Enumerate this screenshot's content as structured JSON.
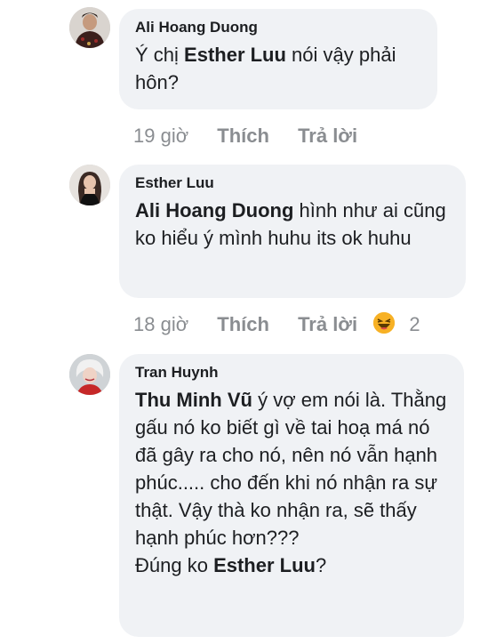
{
  "comments": [
    {
      "author": "Ali Hoang Duong",
      "text_parts": {
        "a": "Ý chị ",
        "mention": "Esther Luu",
        "b": " nói vậy phải hôn?"
      },
      "time": "19 giờ",
      "like_label": "Thích",
      "reply_label": "Trả lời"
    },
    {
      "author": "Esther Luu",
      "text_parts": {
        "mention": "Ali Hoang Duong",
        "b": "  hình như ai cũng ko hiểu ý mình huhu its ok huhu"
      },
      "time": "18 giờ",
      "like_label": "Thích",
      "reply_label": "Trả lời",
      "reaction_icon": "haha-emoji-icon",
      "reaction_count": "2"
    },
    {
      "author": "Tran Huynh",
      "text_parts": {
        "mention": "Thu Minh Vũ",
        "b": " ý vợ em nói là. Thằng gấu nó ko biết gì về tai hoạ má nó đã gây ra cho nó, nên nó vẫn hạnh phúc..... cho đến khi nó nhận ra sự thật. Vậy thà ko nhận ra, sẽ thấy hạnh phúc hơn???",
        "c": "Đúng ko ",
        "mention2": "Esther Luu",
        "d": "?"
      }
    }
  ],
  "colors": {
    "bubble": "#f0f2f5",
    "meta_text": "#8a8d91",
    "text": "#1c1e21",
    "haha_emoji": "#f7b125"
  }
}
